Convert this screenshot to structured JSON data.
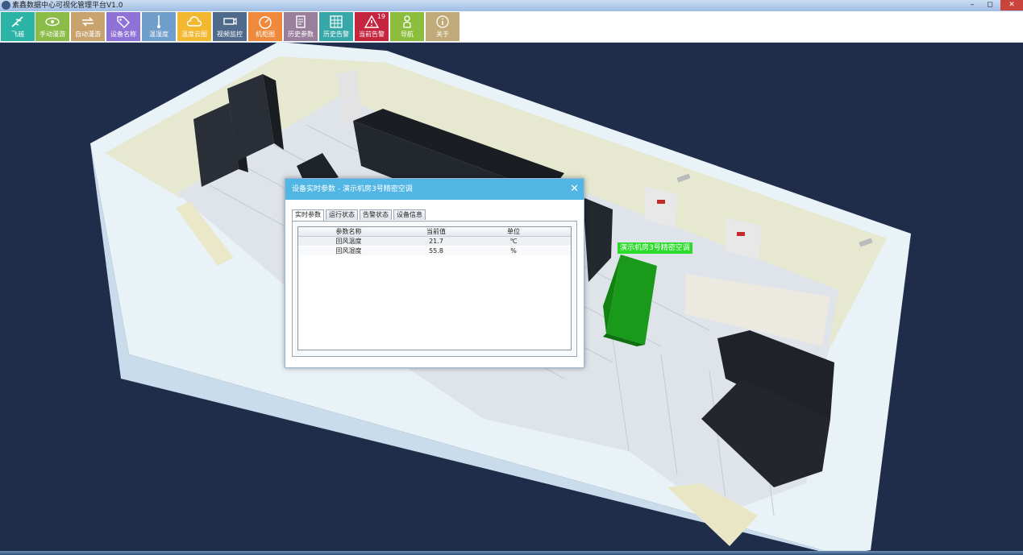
{
  "window": {
    "title": "素鑫数据中心可视化管理平台V1.0",
    "controls": {
      "minimize": "–",
      "maximize": "◻",
      "close": "✕"
    }
  },
  "toolbar": {
    "buttons": [
      {
        "label": "飞越",
        "icon": "plane-icon",
        "color": "#2bb3a6"
      },
      {
        "label": "手动漫游",
        "icon": "eye-icon",
        "color": "#8bbb48"
      },
      {
        "label": "自动漫游",
        "icon": "cycle-arrows-icon",
        "color": "#c9a36e"
      },
      {
        "label": "设备名称",
        "icon": "tag-icon",
        "color": "#8e72d6"
      },
      {
        "label": "温湿度",
        "icon": "thermometer-icon",
        "color": "#6f9ecb"
      },
      {
        "label": "温度云图",
        "icon": "cloud-icon",
        "color": "#f1b830"
      },
      {
        "label": "视频监控",
        "icon": "camera-icon",
        "color": "#4f6a8a"
      },
      {
        "label": "机柜图",
        "icon": "gauge-icon",
        "color": "#ef8a3c"
      },
      {
        "label": "历史参数",
        "icon": "document-icon",
        "color": "#9a7f9c"
      },
      {
        "label": "历史告警",
        "icon": "calendar-grid-icon",
        "color": "#37a7a7"
      },
      {
        "label": "当前告警",
        "icon": "warning-icon",
        "color": "#c6253f",
        "badge": "19"
      },
      {
        "label": "导航",
        "icon": "navigator-icon",
        "color": "#8cbd3c"
      },
      {
        "label": "关于",
        "icon": "info-icon",
        "color": "#c0aa7a"
      }
    ]
  },
  "scene": {
    "device_label": "演示机房3号精密空调"
  },
  "dialog": {
    "title": "设备实时参数 - 演示机房3号精密空调",
    "close": "✕",
    "tabs": [
      "实时参数",
      "运行状态",
      "告警状态",
      "设备信息"
    ],
    "active_tab": 0,
    "columns": [
      "参数名称",
      "当前值",
      "单位"
    ],
    "rows": [
      [
        "回风温度",
        "21.7",
        "℃"
      ],
      [
        "回风湿度",
        "55.8",
        "%"
      ]
    ]
  }
}
